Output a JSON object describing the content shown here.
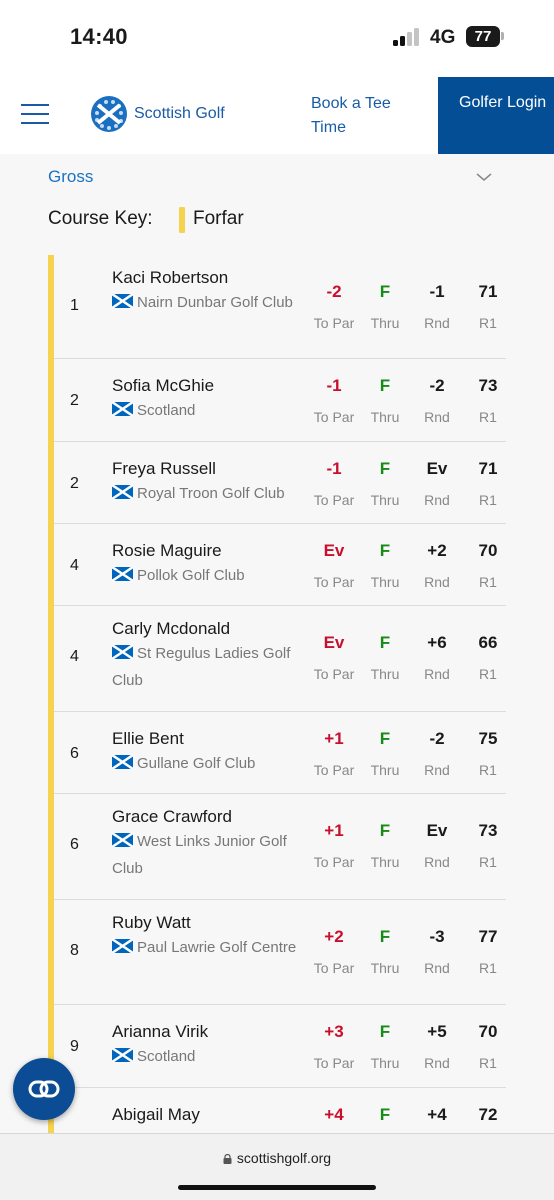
{
  "status_bar": {
    "time": "14:40",
    "network": "4G",
    "battery": "77"
  },
  "header": {
    "logo_text": "Scottish Golf",
    "book_tee_time": "Book a Tee Time",
    "golfer_login": "Golfer Login",
    "brand_color": "#044e96"
  },
  "filters": {
    "score_type": "Gross",
    "course_key_label": "Course Key:",
    "course_name": "Forfar",
    "course_color": "#f5d34f"
  },
  "column_labels": {
    "to_par": "To Par",
    "thru": "Thru",
    "rnd": "Rnd",
    "r1": "R1"
  },
  "rows": [
    {
      "pos": "1",
      "name": "Kaci Robertson",
      "club": "Nairn Dunbar Golf Club",
      "to_par": "-2",
      "thru": "F",
      "rnd": "-1",
      "r1": "71"
    },
    {
      "pos": "2",
      "name": "Sofia McGhie",
      "club": "Scotland",
      "to_par": "-1",
      "thru": "F",
      "rnd": "-2",
      "r1": "73"
    },
    {
      "pos": "2",
      "name": "Freya Russell",
      "club": "Royal Troon Golf Club",
      "to_par": "-1",
      "thru": "F",
      "rnd": "Ev",
      "r1": "71"
    },
    {
      "pos": "4",
      "name": "Rosie Maguire",
      "club": "Pollok Golf Club",
      "to_par": "Ev",
      "thru": "F",
      "rnd": "+2",
      "r1": "70"
    },
    {
      "pos": "4",
      "name": "Carly Mcdonald",
      "club": "St Regulus Ladies Golf Club",
      "to_par": "Ev",
      "thru": "F",
      "rnd": "+6",
      "r1": "66"
    },
    {
      "pos": "6",
      "name": "Ellie Bent",
      "club": "Gullane Golf Club",
      "to_par": "+1",
      "thru": "F",
      "rnd": "-2",
      "r1": "75"
    },
    {
      "pos": "6",
      "name": "Grace Crawford",
      "club": "West Links Junior Golf Club",
      "to_par": "+1",
      "thru": "F",
      "rnd": "Ev",
      "r1": "73"
    },
    {
      "pos": "8",
      "name": "Ruby Watt",
      "club": "Paul Lawrie Golf Centre",
      "to_par": "+2",
      "thru": "F",
      "rnd": "-3",
      "r1": "77"
    },
    {
      "pos": "9",
      "name": "Arianna Virik",
      "club": "Scotland",
      "to_par": "+3",
      "thru": "F",
      "rnd": "+5",
      "r1": "70"
    },
    {
      "pos": "",
      "name": "Abigail May",
      "club": "",
      "to_par": "+4",
      "thru": "F",
      "rnd": "+4",
      "r1": "72"
    }
  ],
  "url_bar": {
    "domain": "scottishgolf.org"
  },
  "icons": {
    "menu": "hamburger-icon",
    "chevron": "chevron-down-icon",
    "flag": "scotland-flag-icon",
    "fab": "link-icon",
    "lock": "lock-icon"
  }
}
